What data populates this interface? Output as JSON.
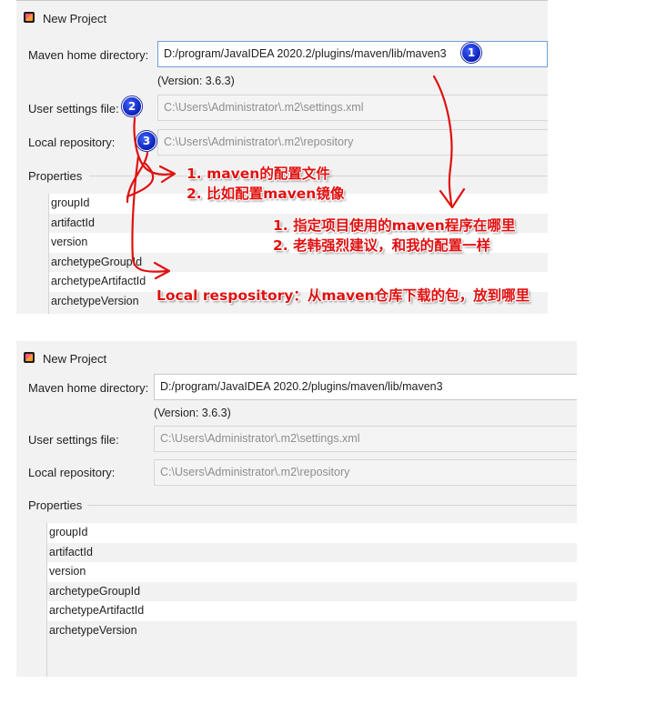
{
  "dialog_title": "New Project",
  "form": {
    "maven_home_label": "Maven home directory:",
    "maven_home_value": "D:/program/JavaIDEA 2020.2/plugins/maven/lib/maven3",
    "version": "(Version: 3.6.3)",
    "user_settings_label": "User settings file:",
    "user_settings_value": "C:\\Users\\Administrator\\.m2\\settings.xml",
    "local_repo_label": "Local repository:",
    "local_repo_value": "C:\\Users\\Administrator\\.m2\\repository",
    "properties_label": "Properties",
    "properties": [
      "groupId",
      "artifactId",
      "version",
      "archetypeGroupId",
      "archetypeArtifactId",
      "archetypeVersion"
    ]
  },
  "badges": [
    "1",
    "2",
    "3"
  ],
  "annotations": {
    "settings_note_1": "1. maven的配置文件",
    "settings_note_2": "2. 比如配置maven镜像",
    "home_note_1": "1. 指定项目使用的maven程序在哪里",
    "home_note_2": "2. 老韩强烈建议，和我的配置一样",
    "repo_note": "Local respository：从maven仓库下载的包，放到哪里"
  },
  "colors": {
    "annotation_red": "#e01010",
    "badge_blue": "#0b1fb8",
    "dialog_bg": "#f2f2f2",
    "focus_border": "#6f9fd8"
  }
}
